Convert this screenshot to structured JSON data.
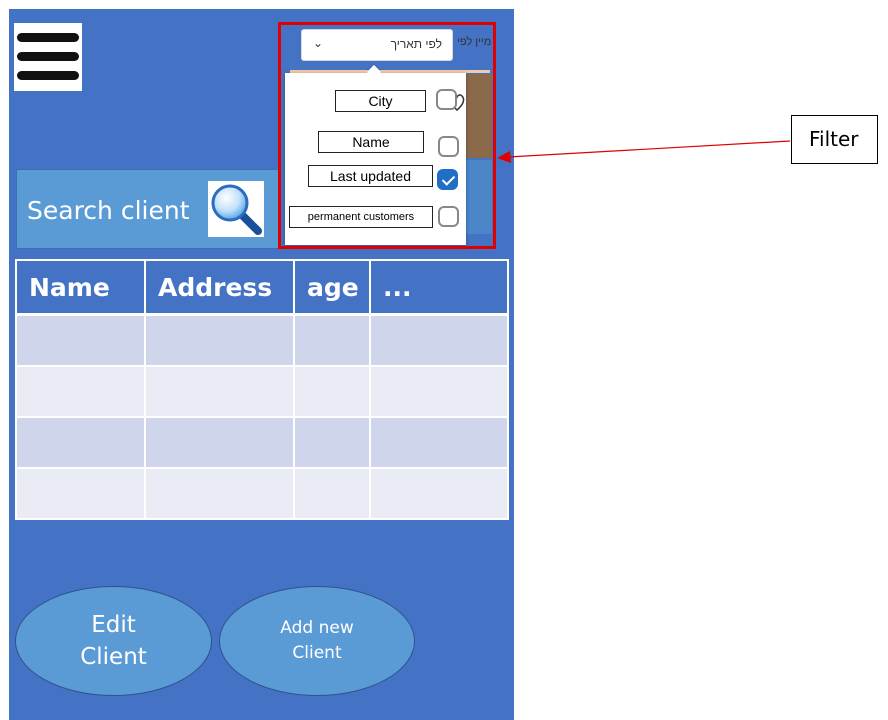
{
  "menu": {
    "icon": "hamburger-menu-icon"
  },
  "search": {
    "label": "Search client",
    "icon": "magnifier-icon"
  },
  "table": {
    "columns": [
      "Name",
      "Address",
      "age",
      "..."
    ],
    "rows": [
      [
        "",
        "",
        "",
        ""
      ],
      [
        "",
        "",
        "",
        ""
      ],
      [
        "",
        "",
        "",
        ""
      ],
      [
        "",
        "",
        "",
        ""
      ]
    ]
  },
  "actions": {
    "edit_label": "Edit\nClient",
    "add_label": "Add new\nClient"
  },
  "filter_popup": {
    "sort_label": "מיין לפי",
    "sort_value": "לפי תאריך",
    "options": [
      {
        "label": "City",
        "checked": false
      },
      {
        "label": "Name",
        "checked": false
      },
      {
        "label": "Last updated",
        "checked": true
      },
      {
        "label": "permanent customers",
        "checked": false
      }
    ]
  },
  "callout": {
    "label": "Filter"
  },
  "colors": {
    "phone_bg": "#4472c4",
    "search_bg": "#5b9bd5",
    "row_odd": "#cfd5ea",
    "row_even": "#e9ebf5",
    "highlight": "#e00000",
    "checkbox_on": "#1f6fc4"
  }
}
